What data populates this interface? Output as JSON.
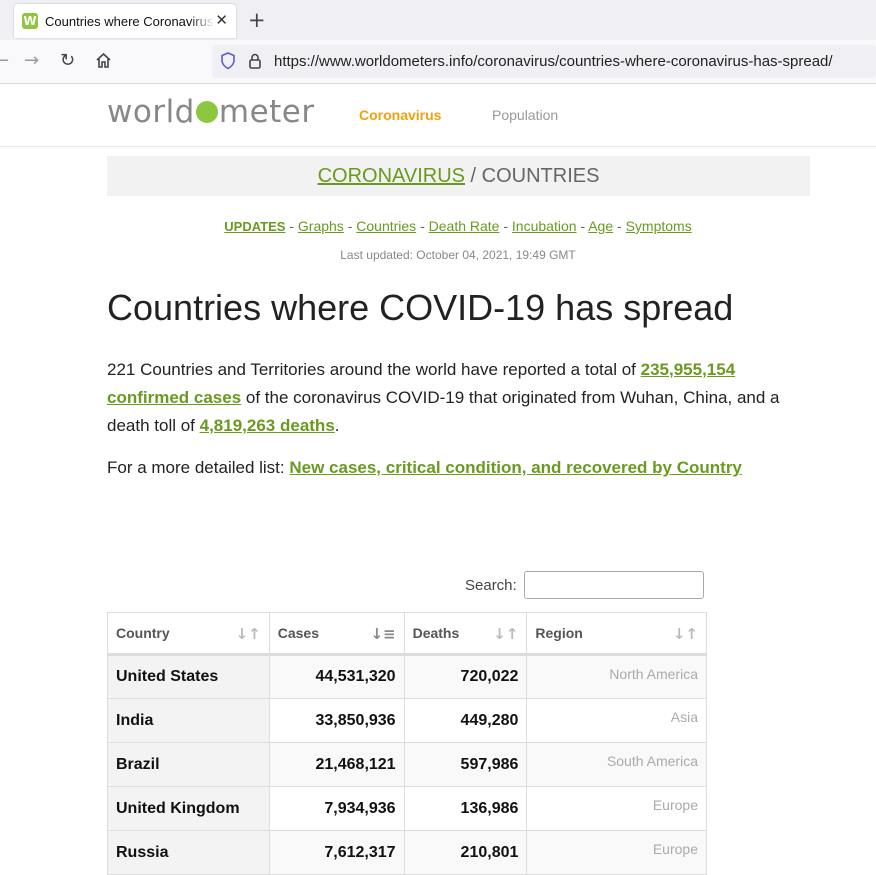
{
  "browser": {
    "tab_title": "Countries where Coronavirus",
    "favicon_letter": "W",
    "url": "https://www.worldometers.info/coronavirus/countries-where-coronavirus-has-spread/"
  },
  "site": {
    "logo_pre": "w",
    "logo_mid": "rld",
    "logo_post": "meter",
    "nav_coronavirus": "Coronavirus",
    "nav_population": "Population"
  },
  "band": {
    "link": "CORONAVIRUS",
    "sep": " / COUNTRIES"
  },
  "sublinks": [
    "UPDATES",
    "Graphs",
    "Countries",
    "Death Rate",
    "Incubation",
    "Age",
    "Symptoms"
  ],
  "last_updated": "Last updated: October 04, 2021, 19:49 GMT",
  "heading": "Countries where COVID-19 has spread",
  "intro": {
    "part1": "221 Countries and Territories around the world have reported a total of ",
    "cases_link": "235,955,154 confirmed cases",
    "part2": " of the coronavirus COVID-19 that originated from Wuhan, China, and a death toll of ",
    "deaths_link": "4,819,263 deaths",
    "part3": "."
  },
  "more": {
    "label": "For a more detailed list: ",
    "link": "New cases, critical condition, and recovered by Country"
  },
  "search": {
    "label": "Search:",
    "value": ""
  },
  "table": {
    "headers": [
      "Country",
      "Cases",
      "Deaths",
      "Region"
    ],
    "rows": [
      {
        "country": "United States",
        "cases": "44,531,320",
        "deaths": "720,022",
        "region": "North America"
      },
      {
        "country": "India",
        "cases": "33,850,936",
        "deaths": "449,280",
        "region": "Asia"
      },
      {
        "country": "Brazil",
        "cases": "21,468,121",
        "deaths": "597,986",
        "region": "South America"
      },
      {
        "country": "United Kingdom",
        "cases": "7,934,936",
        "deaths": "136,986",
        "region": "Europe"
      },
      {
        "country": "Russia",
        "cases": "7,612,317",
        "deaths": "210,801",
        "region": "Europe"
      }
    ]
  }
}
